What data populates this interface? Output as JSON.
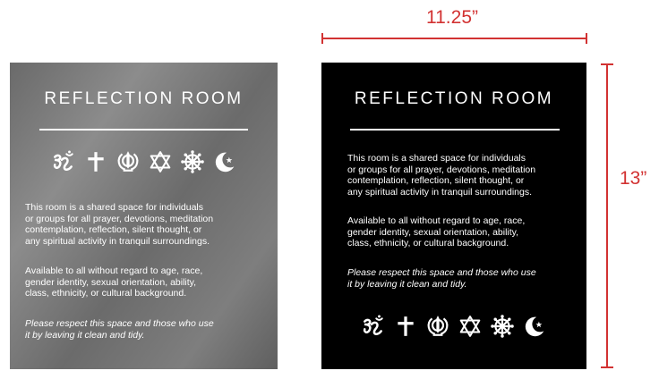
{
  "colors": {
    "gray_sign": "#7a7a7a",
    "black_sign": "#000000",
    "text": "#ffffff",
    "dimension": "#d23232"
  },
  "signs": [
    {
      "variant": "brushed-gray",
      "title": "REFLECTION ROOM",
      "symbols": [
        "om-icon",
        "cross-icon",
        "khanda-icon",
        "star-of-david-icon",
        "dharma-wheel-icon",
        "crescent-star-icon"
      ],
      "paragraph_1": [
        "This room is a shared space for individuals",
        "or groups for all prayer, devotions, meditation",
        "contemplation, reflection, silent thought, or",
        "any spiritual activity in tranquil surroundings."
      ],
      "paragraph_2": [
        "Available to all without regard to age, race,",
        "gender identity, sexual orientation, ability,",
        "class, ethnicity, or cultural background."
      ],
      "note": [
        "Please respect this space and those who use",
        "it by leaving it clean and tidy."
      ]
    },
    {
      "variant": "black",
      "title": "REFLECTION ROOM",
      "symbols": [
        "om-icon",
        "cross-icon",
        "khanda-icon",
        "star-of-david-icon",
        "dharma-wheel-icon",
        "crescent-star-icon"
      ],
      "paragraph_1": [
        "This room is a shared space for individuals",
        "or groups for all prayer, devotions, meditation",
        "contemplation, reflection, silent thought, or",
        "any spiritual activity in tranquil surroundings."
      ],
      "paragraph_2": [
        "Available to all without regard to age, race,",
        "gender identity, sexual orientation, ability,",
        "class, ethnicity, or cultural background."
      ],
      "note": [
        "Please respect this space and those who use",
        "it by leaving it clean and tidy."
      ]
    }
  ],
  "dimensions": {
    "width_label": "11.25”",
    "height_label": "13”"
  }
}
